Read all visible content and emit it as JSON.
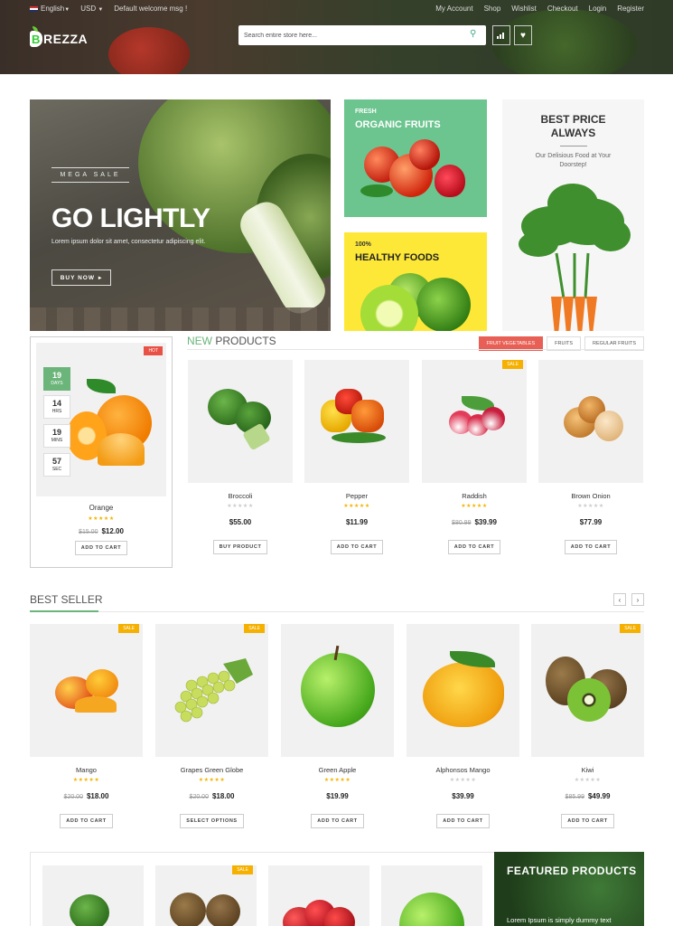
{
  "topbar": {
    "language": "English",
    "currency": "USD",
    "welcome": "Default welcome msg !",
    "links": [
      "My Account",
      "Shop",
      "Wishlist",
      "Checkout",
      "Login",
      "Register"
    ]
  },
  "brand": {
    "logo_letter": "B",
    "logo_text": "REZZA"
  },
  "search": {
    "placeholder": "Search entire store here..."
  },
  "hero": {
    "main": {
      "eyebrow": "MEGA SALE",
      "title": "GO LIGHTLY",
      "text": "Lorem ipsum dolor sit amet, consectetur adipiscing elit.",
      "button": "BUY NOW"
    },
    "fruit": {
      "small": "FRESH",
      "title": "ORGANIC FRUITS"
    },
    "healthy": {
      "small": "100%",
      "title": "HEALTHY FOODS"
    },
    "best": {
      "title": "BEST PRICE ALWAYS",
      "text": "Our Delisious Food at Your Doorstep!"
    }
  },
  "deal": {
    "badge": "HOT",
    "timer": [
      {
        "value": "19",
        "unit": "DAYS"
      },
      {
        "value": "14",
        "unit": "HRS"
      },
      {
        "value": "19",
        "unit": "MINS"
      },
      {
        "value": "57",
        "unit": "SEC"
      }
    ],
    "name": "Orange",
    "stars": "★★★★★",
    "old_price": "$15.00",
    "price": "$12.00",
    "button": "ADD TO CART"
  },
  "new_products": {
    "title_highlight": "NEW",
    "title_rest": " PRODUCTS",
    "tabs": [
      "FRUIT VEGETABLES",
      "FRUITS",
      "REGULAR FRUITS"
    ],
    "items": [
      {
        "name": "Broccoli",
        "stars": "★★★★★",
        "old_price": "",
        "price": "$55.00",
        "button": "BUY PRODUCT"
      },
      {
        "name": "Pepper",
        "stars": "★★★★★",
        "old_price": "",
        "price": "$11.99",
        "button": "ADD TO CART"
      },
      {
        "name": "Raddish",
        "stars": "★★★★★",
        "old_price": "$80.99",
        "price": "$39.99",
        "button": "ADD TO CART",
        "badge": "SALE"
      },
      {
        "name": "Brown Onion",
        "stars": "★★★★★",
        "old_price": "",
        "price": "$77.99",
        "button": "ADD TO CART"
      }
    ]
  },
  "best_seller": {
    "title": "BEST SELLER",
    "items": [
      {
        "name": "Mango",
        "stars": "★★★★★",
        "old_price": "$20.00",
        "price": "$18.00",
        "button": "ADD TO CART",
        "badge": "SALE"
      },
      {
        "name": "Grapes Green Globe",
        "stars": "★★★★★",
        "old_price": "$20.00",
        "price": "$18.00",
        "button": "SELECT OPTIONS",
        "badge": "SALE"
      },
      {
        "name": "Green Apple",
        "stars": "★★★★★",
        "old_price": "",
        "price": "$19.99",
        "button": "ADD TO CART"
      },
      {
        "name": "Alphonsos Mango",
        "stars": "★★★★★",
        "old_price": "",
        "price": "$39.99",
        "button": "ADD TO CART"
      },
      {
        "name": "Kiwi",
        "stars": "★★★★★",
        "old_price": "$85.99",
        "price": "$49.99",
        "button": "ADD TO CART",
        "badge": "SALE"
      }
    ]
  },
  "featured": {
    "title": "FEATURED PRODUCTS",
    "text": "Lorem Ipsum is simply dummy text",
    "badge": "SALE"
  }
}
